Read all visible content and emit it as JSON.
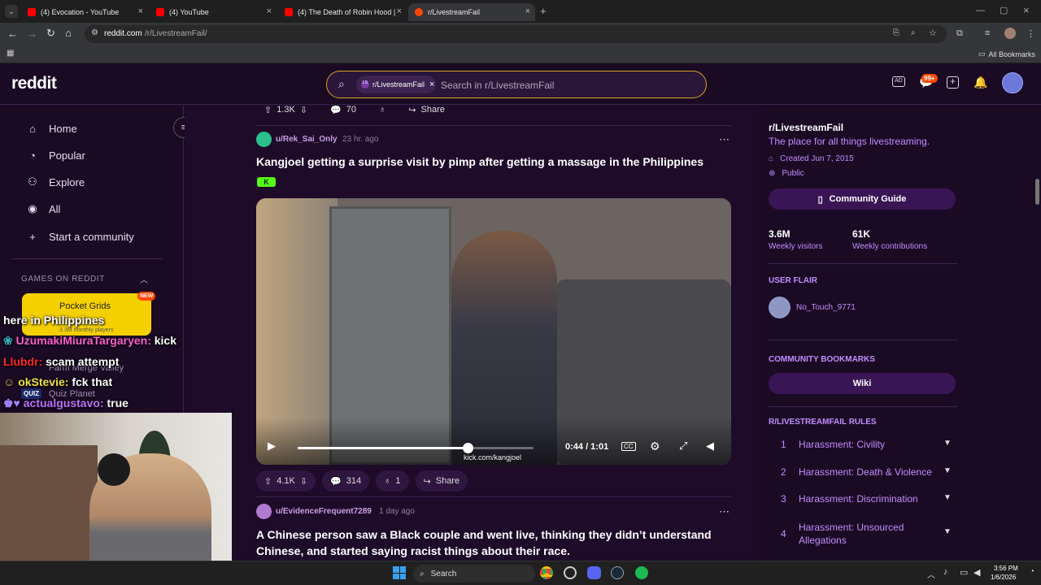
{
  "browser": {
    "tabs": [
      {
        "title": "(4) Evocation - YouTube",
        "color": "#ff0000"
      },
      {
        "title": "(4) YouTube",
        "color": "#ff0000"
      },
      {
        "title": "(4) The Death of Robin Hood |",
        "color": "#ff0000"
      },
      {
        "title": "r/LivestreamFail",
        "color": "#ff4500",
        "active": true
      }
    ],
    "url_host": "reddit.com",
    "url_path": "/r/LivestreamFail/",
    "all_bookmarks": "All Bookmarks"
  },
  "reddit": {
    "logo": "reddit",
    "search": {
      "chip": "r/LivestreamFail",
      "placeholder": "Search in r/LivestreamFail"
    },
    "notif_badge": "99+"
  },
  "sidebar": {
    "items": [
      {
        "label": "Home",
        "icon": "home-icon"
      },
      {
        "label": "Popular",
        "icon": "popular-icon"
      },
      {
        "label": "Explore",
        "icon": "explore-icon"
      },
      {
        "label": "All",
        "icon": "all-icon"
      },
      {
        "label": "Start a community",
        "icon": "plus-icon"
      }
    ],
    "games_heading": "GAMES ON REDDIT",
    "game_card": {
      "title": "Pocket Grids",
      "badge": "NEW",
      "subtitle": "3.3M monthly players"
    },
    "other_games": [
      "Farm Merge Valley",
      "Quiz Planet"
    ],
    "quiz_badge": "QUIZ"
  },
  "top_action": {
    "votes": "1.3K",
    "comments": "70",
    "share": "Share"
  },
  "post1": {
    "author": "u/Rek_Sai_Only",
    "time": "23 hr. ago",
    "title": "Kangjoel getting a surprise visit by pimp after getting a massage in the Philippines",
    "flair": "K",
    "video_time": "0:44 / 1:01",
    "video_progress": 0.72,
    "watermark": "kick.com/kangjoel",
    "votes": "4.1K",
    "comments": "314",
    "awards": "1",
    "share": "Share"
  },
  "post2": {
    "author": "u/EvidenceFrequent7289",
    "time": "1 day ago",
    "title": "A Chinese person saw a Black couple and went live, thinking they didn’t understand Chinese, and started saying racist things about their race."
  },
  "community": {
    "name": "r/LivestreamFail",
    "description": "The place for all things livestreaming.",
    "created": "Created Jun 7, 2015",
    "visibility": "Public",
    "guide_button": "Community Guide",
    "visitors": "3.6M",
    "visitors_label": "Weekly visitors",
    "contributions": "61K",
    "contributions_label": "Weekly contributions",
    "user_flair_heading": "USER FLAIR",
    "username": "No_Touch_9771",
    "bookmarks_heading": "COMMUNITY BOOKMARKS",
    "wiki": "Wiki",
    "rules_heading": "R/LIVESTREAMFAIL RULES",
    "rules": [
      {
        "n": "1",
        "text": "Harassment: Civility"
      },
      {
        "n": "2",
        "text": "Harassment: Death & Violence"
      },
      {
        "n": "3",
        "text": "Harassment: Discrimination"
      },
      {
        "n": "4",
        "text": "Harassment: Unsourced Allegations"
      }
    ]
  },
  "stream_chat": [
    {
      "user": "",
      "text": "here in Philippines",
      "color": "#ffffff"
    },
    {
      "user": "UzumakiMiuraTargaryen:",
      "text": "kick",
      "color": "#ff5fd2"
    },
    {
      "user": "Llubdr:",
      "text": "scam attempt",
      "color": "#ff2a2a"
    },
    {
      "user": "okStevie:",
      "text": "fck that",
      "color": "#f0e040"
    },
    {
      "user": "actualgustavo:",
      "text": "true",
      "color": "#c070ff"
    }
  ],
  "taskbar": {
    "search": "Search",
    "time": "3:56 PM",
    "date": "1/6/2026"
  }
}
